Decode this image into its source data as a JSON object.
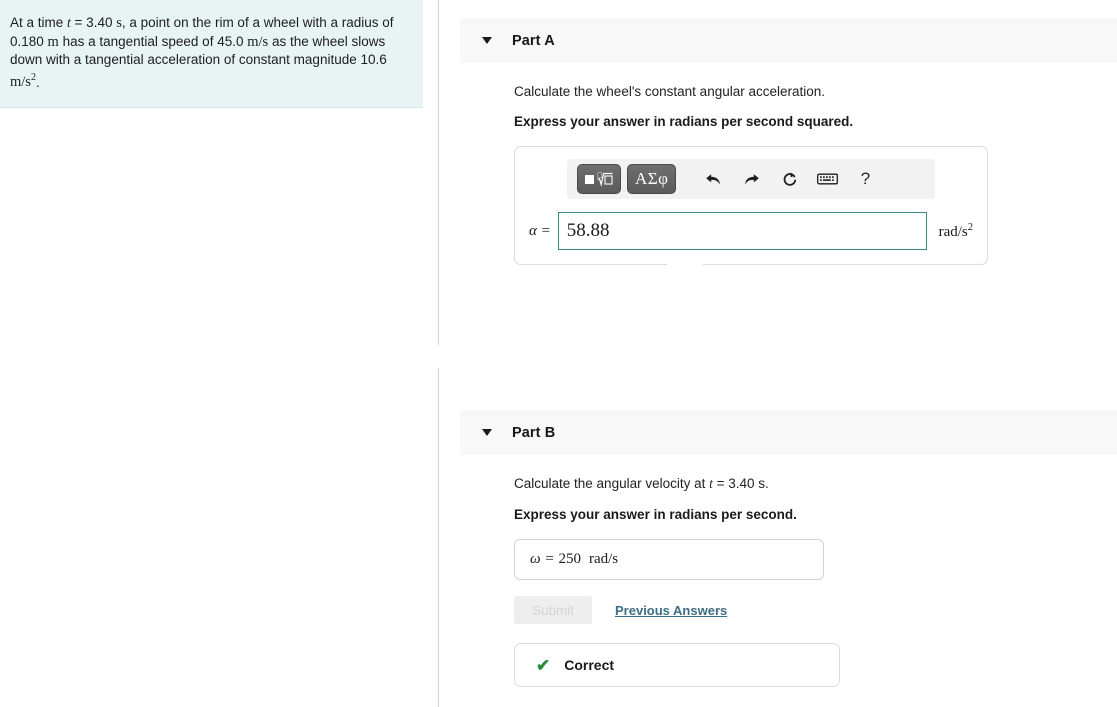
{
  "problem": {
    "text_segments": [
      {
        "t": "At a time ",
        "style": "plain"
      },
      {
        "t": "t",
        "style": "italic-serif"
      },
      {
        "t": " = 3.40 ",
        "style": "plain"
      },
      {
        "t": "s",
        "style": "serif"
      },
      {
        "t": ", a point on the rim of a wheel with a radius of 0.180 ",
        "style": "plain"
      },
      {
        "t": "m",
        "style": "serif"
      },
      {
        "t": " has a tangential speed of 45.0 ",
        "style": "plain"
      },
      {
        "t": "m/s",
        "style": "serif"
      },
      {
        "t": " as the wheel slows down with a tangential acceleration of constant magnitude 10.6 ",
        "style": "plain"
      },
      {
        "t": "m/s²",
        "style": "serif"
      },
      {
        "t": ".",
        "style": "plain"
      }
    ],
    "full_text": "At a time t = 3.40 s, a point on the rim of a wheel with a radius of 0.180 m has a tangential speed of 45.0 m/s as the wheel slows down with a tangential acceleration of constant magnitude 10.6 m/s².",
    "lead": "At a time ",
    "var_t": "t",
    "time_value": " = 3.40 ",
    "unit_s": "s",
    "mid1": ", a point on the rim of a wheel with a radius of 0.180 ",
    "unit_m": "m",
    "mid2": " has a tangential speed of 45.0 ",
    "unit_ms": "m/s",
    "mid3": " as the wheel slows down with a tangential acceleration of constant magnitude 10.6 ",
    "unit_ms2": "m/s",
    "unit_ms2_sup": "2",
    "tail": "."
  },
  "partA": {
    "title": "Part A",
    "prompt": "Calculate the wheel's constant angular acceleration.",
    "instruction": "Express your answer in radians per second squared.",
    "toolbar": {
      "template_button_label": "math-template",
      "greek_button_label": "ΑΣφ",
      "undo_label": "undo",
      "redo_label": "redo",
      "reset_label": "reset",
      "keyboard_label": "keyboard",
      "help_label": "?"
    },
    "variable_label": "α =",
    "answer_value": "58.88",
    "answer_placeholder": "",
    "units": "rad/s",
    "units_sup": "2"
  },
  "partB": {
    "title": "Part B",
    "prompt_lead": "Calculate the angular velocity at ",
    "prompt_var": "t",
    "prompt_tail": " = 3.40 s.",
    "instruction": "Express your answer in radians per second.",
    "variable_label": "ω =",
    "answer_value": "250",
    "units": "rad/s",
    "submit_label": "Submit",
    "previous_answers_label": "Previous Answers",
    "feedback_label": "Correct",
    "check_icon": "✔"
  },
  "colors": {
    "problem_panel_bg": "#e8f4f4",
    "part_header_bg": "#f8f8f8",
    "input_focus_border": "#3b8a8a",
    "link": "#3d6e84",
    "correct_green": "#2e8b3d",
    "toolbar_button": "#5c5c5c",
    "divider": "#c8d8e4"
  }
}
